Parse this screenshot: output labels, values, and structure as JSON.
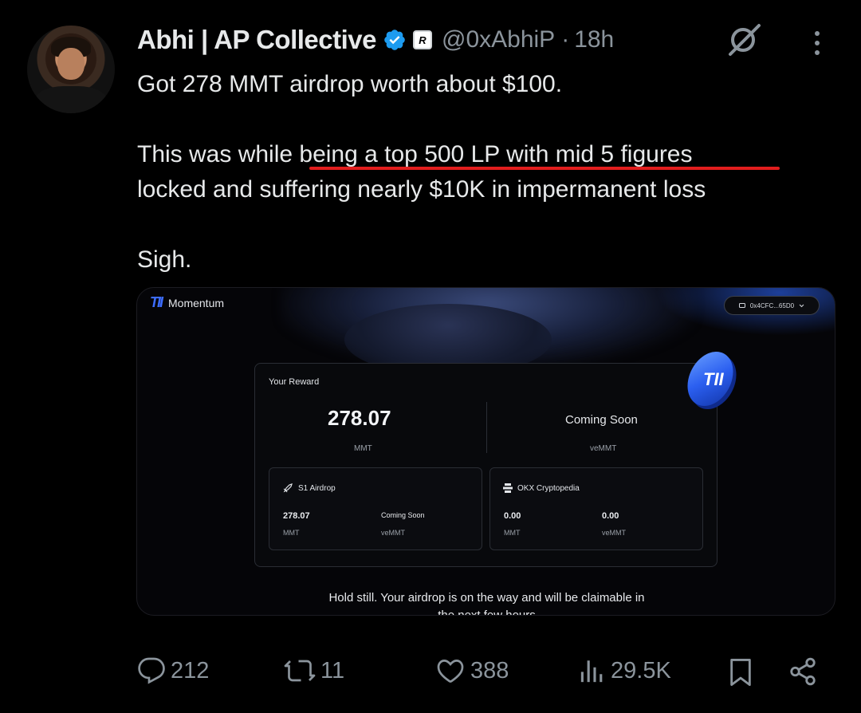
{
  "author": {
    "name": "Abhi | AP Collective",
    "affiliate_badge": "R",
    "handle": "@0xAbhiP",
    "separator": "·",
    "time": "18h"
  },
  "tweet": {
    "lines": [
      "Got 278 MMT airdrop worth about $100.",
      "",
      "This was while being a top 500 LP with mid 5 figures",
      "locked and suffering nearly $10K in impermanent loss",
      "",
      "Sigh."
    ]
  },
  "media": {
    "app_name": "Momentum",
    "app_mark": "TII",
    "wallet": "0x4CFC...65D0",
    "reward": {
      "title": "Your Reward",
      "left_value": "278.07",
      "left_unit": "MMT",
      "right_value": "Coming Soon",
      "right_unit": "veMMT"
    },
    "s1": {
      "title": "S1 Airdrop",
      "val1": "278.07",
      "unit1": "MMT",
      "val2": "Coming Soon",
      "unit2": "veMMT"
    },
    "okx": {
      "title": "OKX Cryptopedia",
      "val1": "0.00",
      "unit1": "MMT",
      "val2": "0.00",
      "unit2": "veMMT"
    },
    "hold_line1": "Hold still. Your airdrop is on the way and will be claimable in",
    "hold_line2": "the next few hours"
  },
  "actions": {
    "replies": "212",
    "reposts": "11",
    "likes": "388",
    "views": "29.5K"
  },
  "colors": {
    "background": "#000000",
    "text": "#e7e9ea",
    "muted": "#8b949c",
    "verified": "#1d9bf0",
    "underline": "#e11d1d",
    "accent": "#3d6dff"
  },
  "icons": [
    "verified-badge-icon",
    "grok-icon",
    "more-icon",
    "reply-icon",
    "repost-icon",
    "like-icon",
    "views-icon",
    "bookmark-icon",
    "share-icon"
  ]
}
